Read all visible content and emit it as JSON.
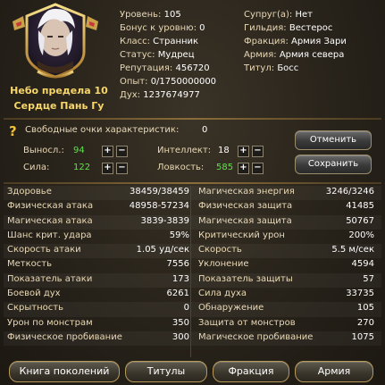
{
  "hero": {
    "name": "Небо предела 10",
    "title_line": "Сердце Пань Гу"
  },
  "info_left": [
    {
      "label": "Уровень:",
      "value": "105"
    },
    {
      "label": "Бонус к уровню:",
      "value": "0"
    },
    {
      "label": "Класс:",
      "value": "Странник"
    },
    {
      "label": "Статус:",
      "value": "Мудрец"
    },
    {
      "label": "Репутация:",
      "value": "456720"
    },
    {
      "label": "Опыт:",
      "value": "0/1750000000"
    },
    {
      "label": "Дух:",
      "value": "1237674977"
    }
  ],
  "info_right": [
    {
      "label": "Супруг(а):",
      "value": "Нет"
    },
    {
      "label": "Гильдия:",
      "value": "Вестерос"
    },
    {
      "label": "Фракция:",
      "value": "Армия Зари"
    },
    {
      "label": "Армия:",
      "value": "Армия севера"
    },
    {
      "label": "Титул:",
      "value": "Босс"
    }
  ],
  "free_points": {
    "label": "Свободные очки характеристик:",
    "value": "0"
  },
  "attributes": {
    "stamina": {
      "label": "Выносл.:",
      "value": "94"
    },
    "strength": {
      "label": "Сила:",
      "value": "122"
    },
    "intellect": {
      "label": "Интеллект:",
      "value": "18"
    },
    "agility": {
      "label": "Ловкость:",
      "value": "585"
    }
  },
  "buttons": {
    "cancel": "Отменить",
    "save": "Сохранить"
  },
  "stats": [
    {
      "l": "Здоровье",
      "lv": "38459/38459",
      "r": "Магическая энергия",
      "rv": "3246/3246"
    },
    {
      "l": "Физическая атака",
      "lv": "48958-57234",
      "r": "Физическая защита",
      "rv": "41485"
    },
    {
      "l": "Магическая атака",
      "lv": "3839-3839",
      "r": "Магическая защита",
      "rv": "50767"
    },
    {
      "l": "Шанс крит. удара",
      "lv": "59%",
      "r": "Критический урон",
      "rv": "200%"
    },
    {
      "l": "Скорость атаки",
      "lv": "1.05 уд/сек",
      "r": "Скорость",
      "rv": "5.5 м/сек"
    },
    {
      "l": "Меткость",
      "lv": "7556",
      "r": "Уклонение",
      "rv": "4594"
    },
    {
      "l": "Показатель атаки",
      "lv": "173",
      "r": "Показатель защиты",
      "rv": "57"
    },
    {
      "l": "Боевой дух",
      "lv": "6261",
      "r": "Сила духа",
      "rv": "33735"
    },
    {
      "l": "Скрытность",
      "lv": "0",
      "r": "Обнаружение",
      "rv": "105"
    },
    {
      "l": "Урон по монстрам",
      "lv": "350",
      "r": "Защита от монстров",
      "rv": "270"
    },
    {
      "l": "Физическое пробивание",
      "lv": "300",
      "r": "Магическое пробивание",
      "rv": "1075"
    }
  ],
  "bottom_buttons": {
    "generations": "Книга поколений",
    "titles": "Титулы",
    "faction": "Фракция",
    "army": "Армия"
  },
  "colors": {
    "accent_gold": "#f7d66a",
    "green_value": "#5fe04a",
    "label": "#ead9b5"
  }
}
